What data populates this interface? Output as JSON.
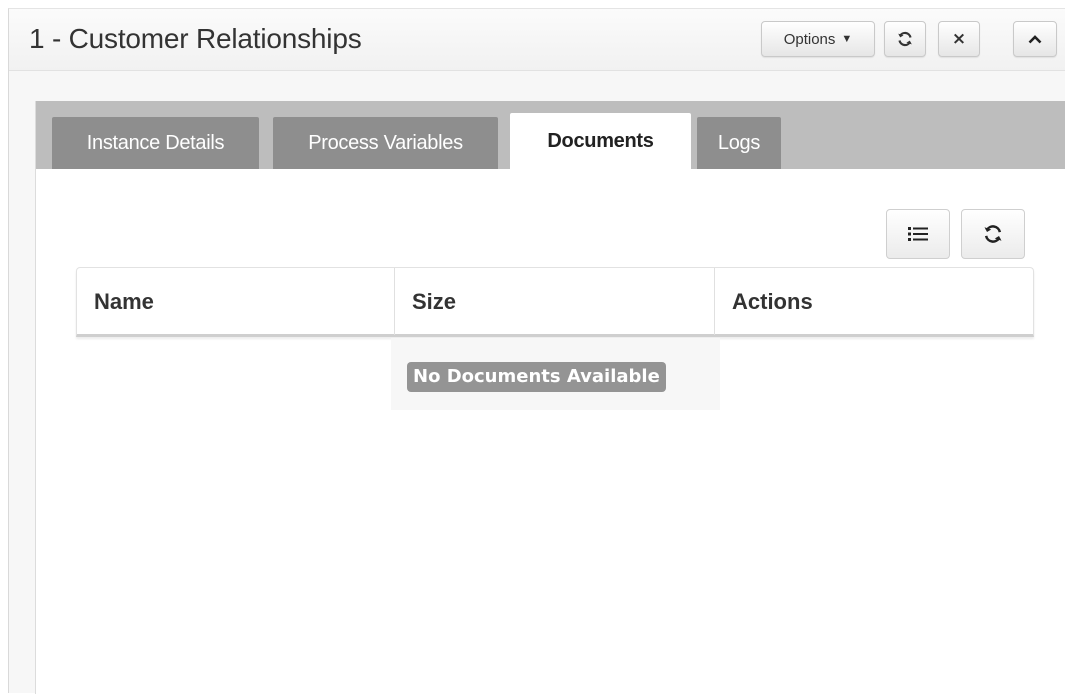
{
  "header": {
    "title": "1 - Customer Relationships",
    "options_label": "Options",
    "options_caret": "▼",
    "refresh_glyph": "⟳",
    "close_glyph": "×",
    "collapse_glyph": "^"
  },
  "tabs": [
    {
      "label": "Instance Details",
      "active": false
    },
    {
      "label": "Process Variables",
      "active": false
    },
    {
      "label": "Documents",
      "active": true
    },
    {
      "label": "Logs",
      "active": false
    }
  ],
  "toolbar": {
    "list_icon": "list-icon",
    "refresh_icon": "refresh-icon"
  },
  "table": {
    "columns": [
      "Name",
      "Size",
      "Actions"
    ],
    "empty_message": "No Documents Available"
  },
  "colors": {
    "tab_inactive": "#8e8e8e",
    "tab_bar": "#bdbdbd",
    "badge": "#949494"
  }
}
